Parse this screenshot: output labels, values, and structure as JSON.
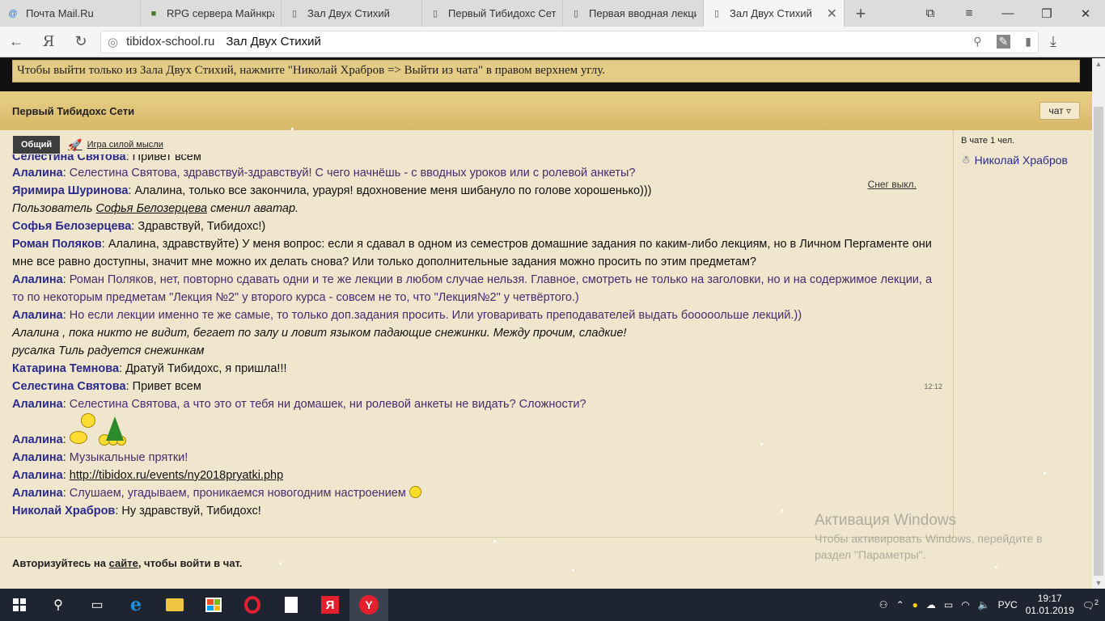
{
  "browser": {
    "tabs": [
      {
        "label": "Почта Mail.Ru",
        "icon": "@",
        "icon_color": "#1a73e8",
        "active": false
      },
      {
        "label": "RPG сервера Майнкра",
        "icon": "■",
        "icon_color": "#4a7a2a",
        "active": false
      },
      {
        "label": "Зал Двух Стихий",
        "icon": "▯",
        "icon_color": "#555",
        "active": false
      },
      {
        "label": "Первый Тибидохс Сет",
        "icon": "▯",
        "icon_color": "#555",
        "active": false
      },
      {
        "label": "Первая вводная лекци",
        "icon": "▯",
        "icon_color": "#555",
        "active": false
      },
      {
        "label": "Зал Двух Стихий",
        "icon": "▯",
        "icon_color": "#555",
        "active": true
      }
    ],
    "address": {
      "domain": "tibidox-school.ru",
      "page_title": "Зал Двух Стихий"
    }
  },
  "page": {
    "notice": "Чтобы выйти только из Зала Двух Стихий, нажмите \"Николай Храбров => Выйти из чата\" в правом верхнем углу.",
    "chat_title": "Первый Тибидохс Сети",
    "chat_select": "чат",
    "tabs": {
      "common": "Общий",
      "game": "Игра силой мысли"
    },
    "snow_toggle": "Снег выкл.",
    "timestamp": "12:12",
    "messages": [
      {
        "type": "cut",
        "author": "Селестина Святова",
        "text": "Привет всем"
      },
      {
        "type": "msg",
        "author": "Алалина",
        "text": "Селестина Святова, здравствуй-здравствуй! С чего начнёшь - с вводных уроков или с ролевой анкеты?",
        "purple": true
      },
      {
        "type": "msg",
        "author": "Яримира Шуринова",
        "text": "Алалина, только все закончила, урауря! вдохновение меня шибануло по голове хорошенько)))"
      },
      {
        "type": "sys_avatar",
        "prefix": "Пользователь ",
        "user": "Софья Белозерцева",
        "suffix": " сменил аватар."
      },
      {
        "type": "msg",
        "author": "Софья Белозерцева",
        "text": "Здравствуй, Тибидохс!)"
      },
      {
        "type": "msg",
        "author": "Роман Поляков",
        "text": "Алалина, здравствуйте) У меня вопрос: если я сдавал в одном из семестров домашние задания по каким-либо лекциям, но в Личном Пергаменте они мне все равно доступны, значит мне можно их делать снова? Или только дополнительные задания можно просить по этим предметам?"
      },
      {
        "type": "msg",
        "author": "Алалина",
        "text": "Роман Поляков, нет, повторно сдавать одни и те же лекции в любом случае нельзя. Главное, смотреть не только на заголовки, но и на содержимое лекции, а то по некоторым предметам \"Лекция №2\" у второго курса - совсем не то, что \"Лекция№2\" у четвёртого.)",
        "purple": true
      },
      {
        "type": "msg",
        "author": "Алалина",
        "text": "Но если лекции именно те же самые, то только доп.задания просить. Или уговаривать преподавателей выдать бооооольше лекций.))",
        "purple": true
      },
      {
        "type": "sys",
        "text": "Алалина , пока никто не видит, бегает по залу и ловит языком падающие снежинки. Между прочим, сладкие!"
      },
      {
        "type": "sys",
        "text": "русалка Тиль радуется снежинкам"
      },
      {
        "type": "msg",
        "author": "Катарина Темнова",
        "text": "Дратуй Тибидохс, я пришла!!!"
      },
      {
        "type": "msg",
        "author": "Селестина Святова",
        "text": "Привет всем",
        "timestamp": true
      },
      {
        "type": "msg",
        "author": "Алалина",
        "text": "Селестина Святова, а что это от тебя ни домашек, ни ролевой анкеты не видать? Сложности?",
        "purple": true
      },
      {
        "type": "stickers",
        "author": "Алалина"
      },
      {
        "type": "msg",
        "author": "Алалина",
        "text": "Музыкальные прятки!",
        "purple": true
      },
      {
        "type": "link",
        "author": "Алалина",
        "link": "http://tibidox.ru/events/ny2018pryatki.php"
      },
      {
        "type": "smile",
        "author": "Алалина",
        "text": "Слушаем, угадываем, проникаемся новогодним настроением",
        "purple": true
      },
      {
        "type": "msg",
        "author": "Николай Храбров",
        "text": "Ну здравствуй, Тибидохс!"
      }
    ],
    "auth": {
      "prefix": "Авторизуйтесь на ",
      "link": "сайте",
      "suffix": ", чтобы войти в чат."
    },
    "sidebar": {
      "count_text": "В чате 1 чел.",
      "members": [
        "Николай Храбров"
      ]
    }
  },
  "watermark": {
    "title": "Активация Windows",
    "line1": "Чтобы активировать Windows, перейдите в",
    "line2": "раздел \"Параметры\"."
  },
  "taskbar": {
    "language": "РУС",
    "time": "19:17",
    "date": "01.01.2019",
    "notifications": "2"
  }
}
